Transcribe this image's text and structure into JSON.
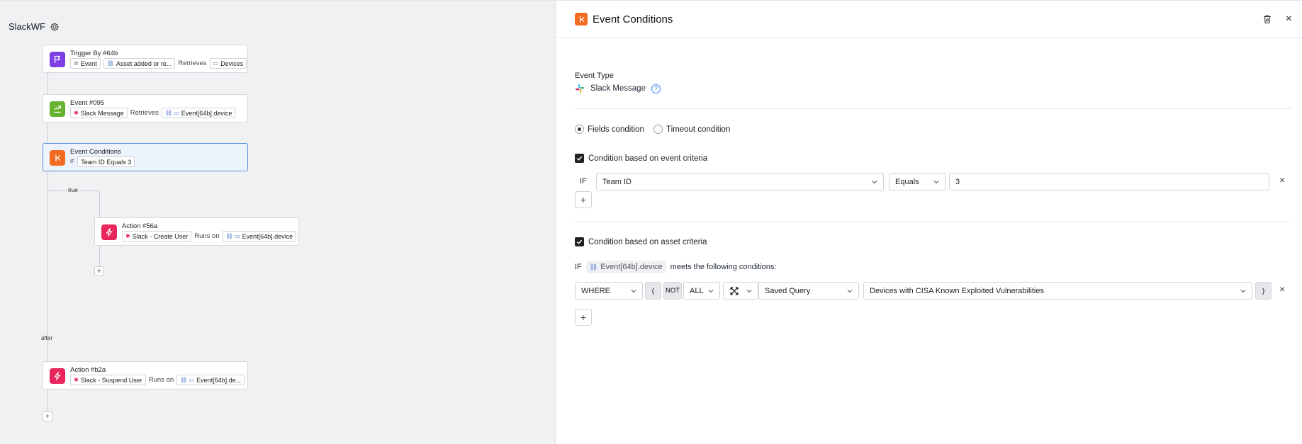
{
  "workflow": {
    "name": "SlackWF",
    "nodes": {
      "trigger": {
        "title": "Trigger By #64b",
        "chip1": "Event",
        "chip2": "Asset added or re...",
        "connector": "Retrieves",
        "chip3": "Devices"
      },
      "event": {
        "title": "Event #095",
        "chip1": "Slack Message",
        "connector": "Retrieves",
        "chip2": "Event[64b].device"
      },
      "conditions": {
        "title": "Event Conditions",
        "if_label": "IF",
        "chip1": "Team ID Equals 3"
      },
      "action56a": {
        "title": "Action #56a",
        "chip1": "Slack - Create User",
        "connector": "Runs on",
        "chip2": "Event[64b].device"
      },
      "actionb2a": {
        "title": "Action #b2a",
        "chip1": "Slack - Suspend User",
        "connector": "Runs on",
        "chip2": "Event[64b].de..."
      }
    },
    "branch_true": "true",
    "branch_after": "after",
    "add_label": "+"
  },
  "panel": {
    "title": "Event Conditions",
    "event_type_label": "Event Type",
    "event_type_value": "Slack Message",
    "radios": {
      "fields": "Fields condition",
      "timeout": "Timeout condition"
    },
    "event_criteria": {
      "label": "Condition based on event criteria",
      "if_label": "IF",
      "field": "Team ID",
      "operator": "Equals",
      "value": "3"
    },
    "asset_criteria": {
      "label": "Condition based on asset criteria",
      "if_label": "IF",
      "entity": "Event[64b].device",
      "suffix": "meets the following conditions:",
      "where": "WHERE",
      "open_paren": "(",
      "not": "NOT",
      "all": "ALL",
      "type": "Saved Query",
      "query": "Devices with CISA Known Exploited Vulnerabilities",
      "close_paren": ")"
    },
    "add_label": "+",
    "close_glyph": "×"
  },
  "colors": {
    "trigger": "#7b3fe4",
    "event": "#65b32e",
    "conditions": "#f26b21",
    "action": "#e8255c",
    "selected_border": "#5b8fd6"
  }
}
